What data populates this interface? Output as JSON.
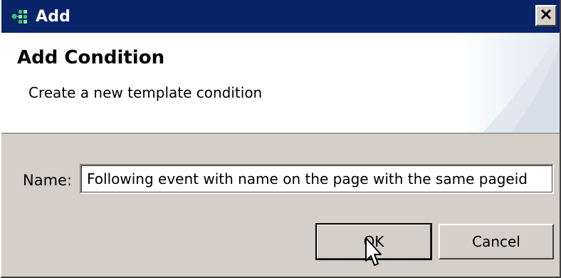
{
  "window": {
    "title": "Add",
    "close_label": "X"
  },
  "banner": {
    "title": "Add Condition",
    "description": "Create a new template condition"
  },
  "form": {
    "name_label": "Name:",
    "name_value": "Following event with name on the page with the same pageid"
  },
  "buttons": {
    "ok_label": "OK",
    "cancel_label": "Cancel"
  },
  "icons": {
    "title_icon": "template-icon",
    "close_icon": "close-icon",
    "cursor": "mouse-pointer-icon"
  },
  "colors": {
    "titlebar": "#0a246a",
    "dialog_bg": "#d4d0c8"
  }
}
